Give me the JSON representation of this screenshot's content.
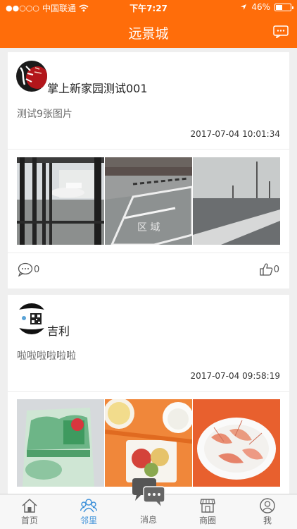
{
  "status_bar": {
    "signal": "●●○○○",
    "carrier": "中国联通",
    "time": "下午7:27",
    "battery": "46%",
    "battery_level": 0.46
  },
  "nav": {
    "title": "远景城",
    "message_icon": "chat-bubble-icon"
  },
  "posts": [
    {
      "username": "掌上新家园测试001",
      "text": "测试9张图片",
      "time": "2017-07-04 10:01:34",
      "comments": "0",
      "likes": "0"
    },
    {
      "username": "吉利",
      "text": "啦啦啦啦啦啦",
      "time": "2017-07-04 09:58:19"
    }
  ],
  "tabs": [
    {
      "label": "首页",
      "icon": "home-icon"
    },
    {
      "label": "邻里",
      "icon": "neighbors-icon",
      "active": true
    },
    {
      "label": "消息",
      "icon": "message-bubbles-icon"
    },
    {
      "label": "商圈",
      "icon": "shop-icon"
    },
    {
      "label": "我",
      "icon": "profile-icon"
    }
  ],
  "colors": {
    "brand": "#ff6d0a",
    "active_tab": "#3a8fd9"
  }
}
